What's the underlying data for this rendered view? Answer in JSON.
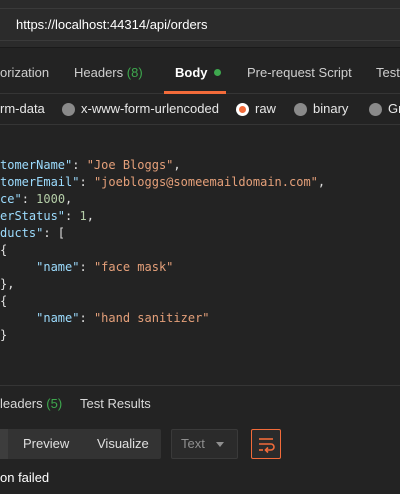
{
  "request": {
    "url": "https://localhost:44314/api/orders"
  },
  "request_tabs": [
    {
      "label": "orization",
      "count": ""
    },
    {
      "label": "Headers",
      "count": "(8)"
    },
    {
      "label": "Body",
      "count": ""
    },
    {
      "label": "Pre-request Script",
      "count": ""
    },
    {
      "label": "Test",
      "count": ""
    }
  ],
  "body_types": [
    {
      "label": "rm-data",
      "selected": false
    },
    {
      "label": "x-www-form-urlencoded",
      "selected": false
    },
    {
      "label": "raw",
      "selected": true
    },
    {
      "label": "binary",
      "selected": false
    },
    {
      "label": "Gr",
      "selected": false
    }
  ],
  "code": {
    "line1_key": "tomerName\"",
    "line1_val": "\"Joe Bloggs\"",
    "line2_key": "tomerEmail\"",
    "line2_val": "\"joebloggs@someemaildomain.com\"",
    "line3_key": "ce\"",
    "line3_val": "1000",
    "line4_key": "erStatus\"",
    "line4_val": "1",
    "line5_key": "ducts\"",
    "line5_rest": ": [",
    "open_brace": "{",
    "name_key": "\"name\"",
    "product1_name": "\"face mask\"",
    "close_brace_comma": "},",
    "product2_name": "\"hand sanitizer\"",
    "close_brace": "}"
  },
  "response_tabs": [
    {
      "label": "leaders",
      "count": "(5)"
    },
    {
      "label": "Test Results",
      "count": ""
    }
  ],
  "response_toolbar": {
    "preview_label": "Preview",
    "visualize_label": "Visualize",
    "format_value": "Text"
  },
  "status_text": "on failed",
  "colors": {
    "accent": "#f26b3a",
    "count_green": "#3ea84e"
  },
  "icons": [
    "wrap-lines-icon",
    "chevron-down-icon",
    "active-dot-icon"
  ]
}
